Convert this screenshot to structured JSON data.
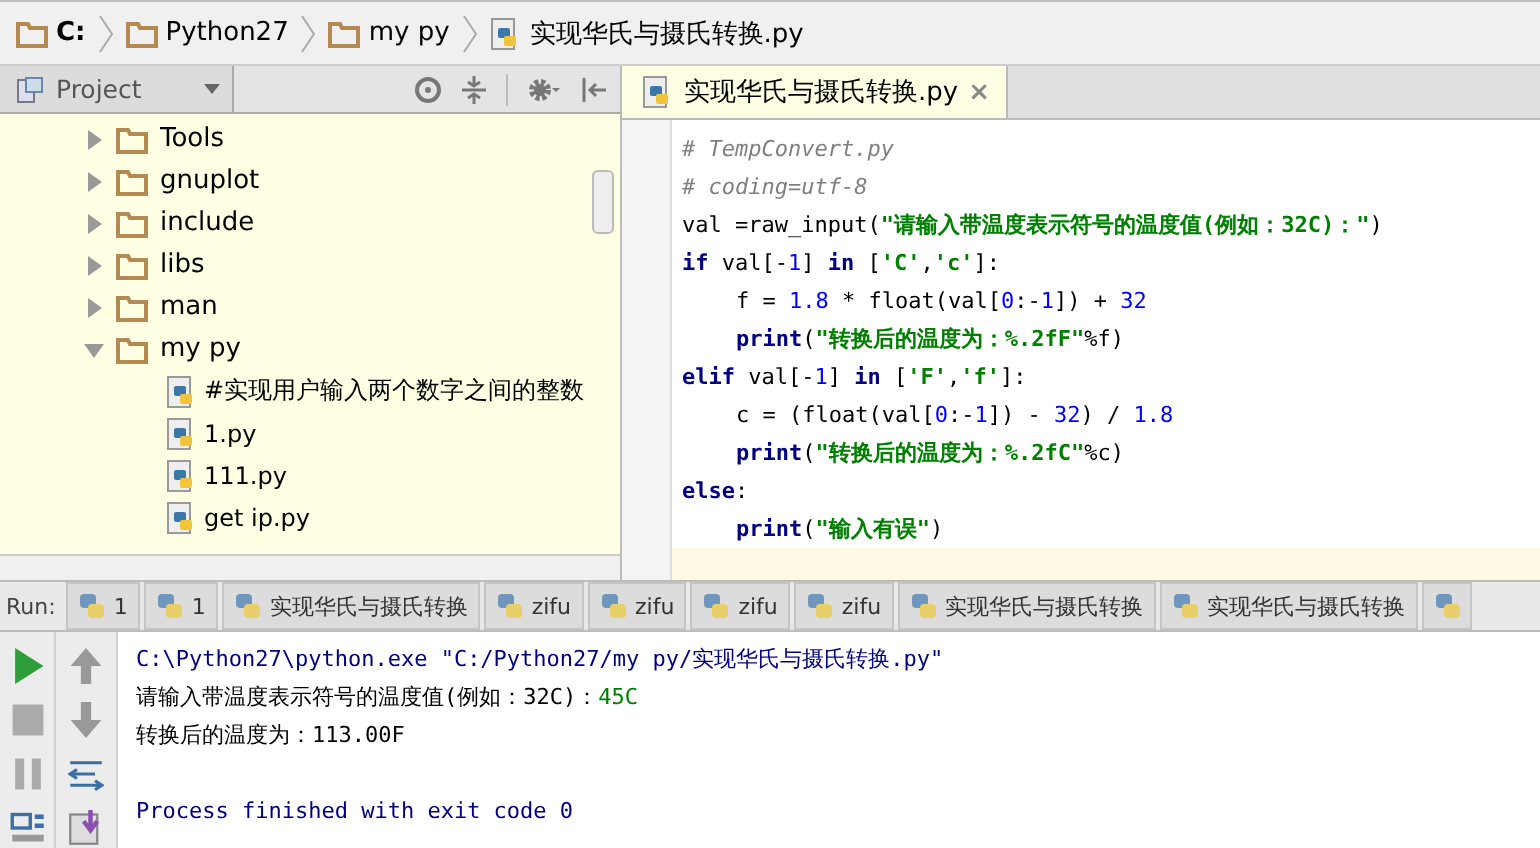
{
  "breadcrumb": [
    {
      "kind": "folder",
      "label": "C:"
    },
    {
      "kind": "folder",
      "label": "Python27"
    },
    {
      "kind": "folder",
      "label": "my py"
    },
    {
      "kind": "file",
      "label": "实现华氏与摄氏转换.py"
    }
  ],
  "project_panel": {
    "title": "Project",
    "tree": [
      {
        "kind": "folder",
        "label": "Tools",
        "expanded": false
      },
      {
        "kind": "folder",
        "label": "gnuplot",
        "expanded": false
      },
      {
        "kind": "folder",
        "label": "include",
        "expanded": false
      },
      {
        "kind": "folder",
        "label": "libs",
        "expanded": false
      },
      {
        "kind": "folder",
        "label": "man",
        "expanded": false
      },
      {
        "kind": "folder",
        "label": "my py",
        "expanded": true,
        "children": [
          {
            "kind": "file",
            "label": "#实现用户输入两个数字之间的整数"
          },
          {
            "kind": "file",
            "label": "1.py"
          },
          {
            "kind": "file",
            "label": "111.py"
          },
          {
            "kind": "file",
            "label": "get ip.py"
          }
        ]
      }
    ]
  },
  "editor": {
    "tab": {
      "label": "实现华氏与摄氏转换.py",
      "close": "×"
    },
    "lines": [
      [
        {
          "kind": "comment",
          "text": "# TempConvert.py"
        }
      ],
      [
        {
          "kind": "comment",
          "text": "# coding=utf-8"
        }
      ],
      [
        {
          "kind": "plain",
          "text": "val =raw_input("
        },
        {
          "kind": "string",
          "text": "\"请输入带温度表示符号的温度值(例如：32C)：\""
        },
        {
          "kind": "plain",
          "text": ")"
        }
      ],
      [
        {
          "kind": "keyword",
          "text": "if"
        },
        {
          "kind": "plain",
          "text": " val[-"
        },
        {
          "kind": "number",
          "text": "1"
        },
        {
          "kind": "plain",
          "text": "] "
        },
        {
          "kind": "keyword",
          "text": "in"
        },
        {
          "kind": "plain",
          "text": " ["
        },
        {
          "kind": "string",
          "text": "'C'"
        },
        {
          "kind": "plain",
          "text": ","
        },
        {
          "kind": "string",
          "text": "'c'"
        },
        {
          "kind": "plain",
          "text": "]:"
        }
      ],
      [
        {
          "kind": "plain",
          "text": "f = "
        },
        {
          "kind": "number",
          "text": "1.8"
        },
        {
          "kind": "plain",
          "text": " * float(val["
        },
        {
          "kind": "number",
          "text": "0"
        },
        {
          "kind": "plain",
          "text": ":-"
        },
        {
          "kind": "number",
          "text": "1"
        },
        {
          "kind": "plain",
          "text": "]) + "
        },
        {
          "kind": "number",
          "text": "32"
        }
      ],
      [
        {
          "kind": "keyword",
          "text": "print"
        },
        {
          "kind": "plain",
          "text": "("
        },
        {
          "kind": "string",
          "text": "\"转换后的温度为：%.2fF\""
        },
        {
          "kind": "plain",
          "text": "%f)"
        }
      ],
      [
        {
          "kind": "keyword",
          "text": "elif"
        },
        {
          "kind": "plain",
          "text": " val[-"
        },
        {
          "kind": "number",
          "text": "1"
        },
        {
          "kind": "plain",
          "text": "] "
        },
        {
          "kind": "keyword",
          "text": "in"
        },
        {
          "kind": "plain",
          "text": " ["
        },
        {
          "kind": "string",
          "text": "'F'"
        },
        {
          "kind": "plain",
          "text": ","
        },
        {
          "kind": "string",
          "text": "'f'"
        },
        {
          "kind": "plain",
          "text": "]:"
        }
      ],
      [
        {
          "kind": "plain",
          "text": "c = (float(val["
        },
        {
          "kind": "number",
          "text": "0"
        },
        {
          "kind": "plain",
          "text": ":-"
        },
        {
          "kind": "number",
          "text": "1"
        },
        {
          "kind": "plain",
          "text": "]) - "
        },
        {
          "kind": "number",
          "text": "32"
        },
        {
          "kind": "plain",
          "text": ") / "
        },
        {
          "kind": "number",
          "text": "1.8"
        }
      ],
      [
        {
          "kind": "keyword",
          "text": "print"
        },
        {
          "kind": "plain",
          "text": "("
        },
        {
          "kind": "string",
          "text": "\"转换后的温度为：%.2fC\""
        },
        {
          "kind": "plain",
          "text": "%c)"
        }
      ],
      [
        {
          "kind": "keyword",
          "text": "else"
        },
        {
          "kind": "plain",
          "text": ":"
        }
      ],
      [
        {
          "kind": "keyword",
          "text": "print"
        },
        {
          "kind": "plain",
          "text": "("
        },
        {
          "kind": "string",
          "text": "\"输入有误\""
        },
        {
          "kind": "plain",
          "text": ")"
        }
      ]
    ]
  },
  "run_bar": {
    "label": "Run:",
    "tabs": [
      "1",
      "1",
      "实现华氏与摄氏转换",
      "zifu",
      "zifu",
      "zifu",
      "zifu",
      "实现华氏与摄氏转换",
      "实现华氏与摄氏转换"
    ]
  },
  "console": [
    [
      {
        "kind": "command",
        "text": "C:\\Python27\\python.exe \"C:/Python27/my py/实现华氏与摄氏转换.py\""
      }
    ],
    [
      {
        "kind": "output",
        "text": "请输入带温度表示符号的温度值(例如：32C)："
      },
      {
        "kind": "input",
        "text": "45C"
      }
    ],
    [
      {
        "kind": "output",
        "text": "转换后的温度为：113.00F"
      }
    ],
    [
      {
        "kind": "info",
        "text": "Process finished with exit code 0"
      }
    ]
  ]
}
